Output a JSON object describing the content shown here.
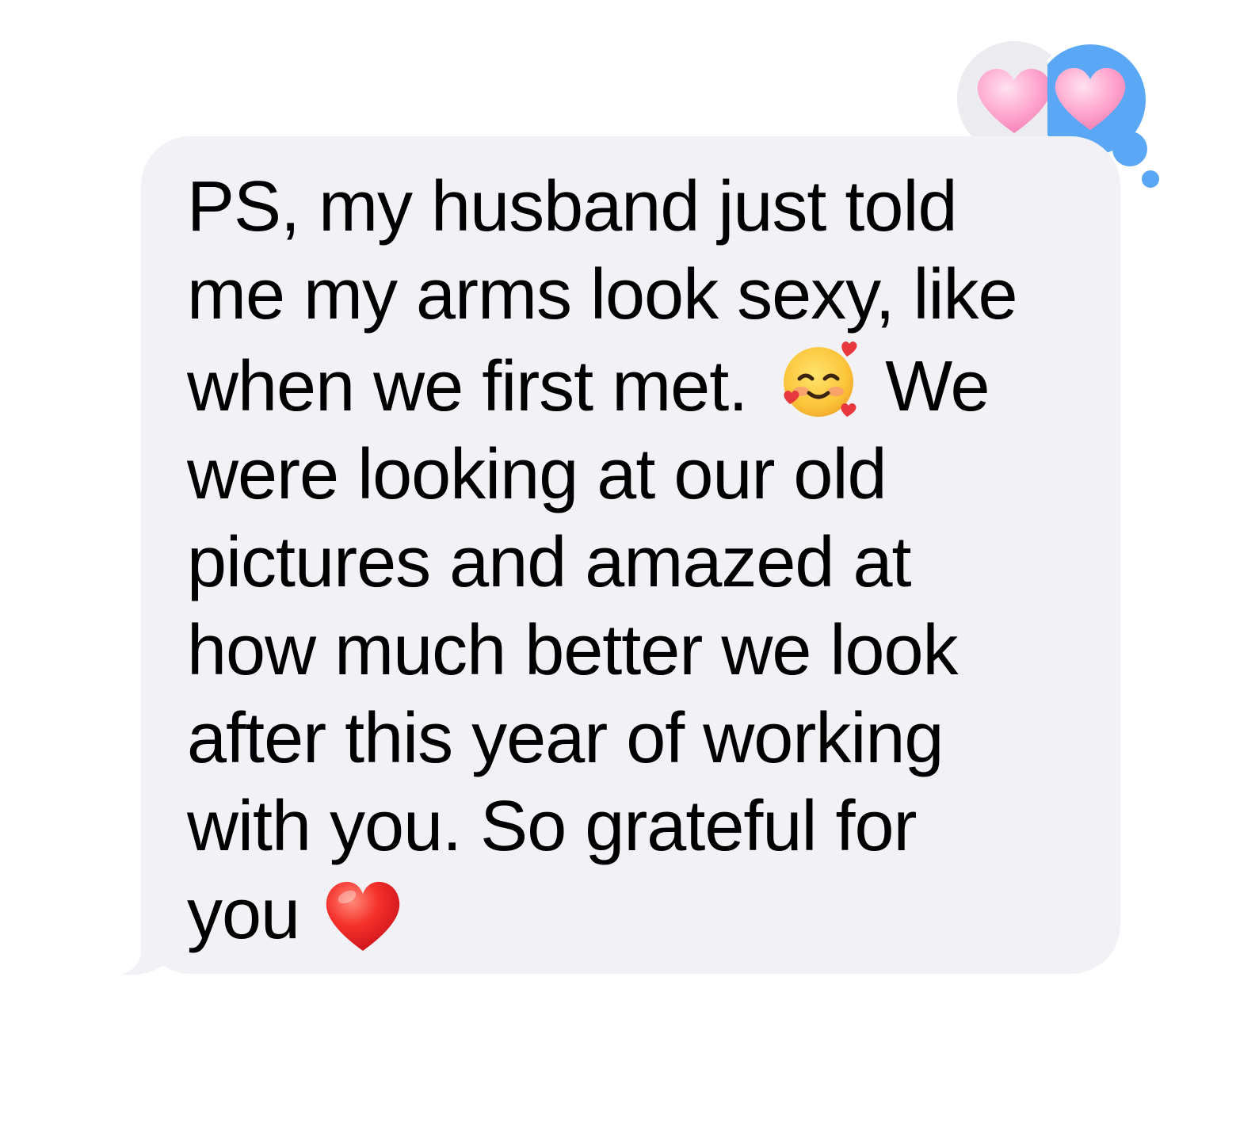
{
  "message": {
    "lines": [
      "PS, my husband just told",
      "me my arms look sexy, like",
      "when we first met.",
      "We",
      "were looking at our old",
      "pictures and amazed at",
      "how much better we look",
      "after this year of working",
      "with you.  So grateful for",
      "you"
    ],
    "emojis": [
      "smiling-face-with-hearts",
      "red-heart"
    ]
  },
  "reactions": [
    {
      "emoji": "pink-heart",
      "style": "received",
      "background": "#ececf0"
    },
    {
      "emoji": "pink-heart",
      "style": "sent",
      "background": "#5aa7f5"
    }
  ],
  "colors": {
    "bubble": "#f2f2f6",
    "text": "#000000",
    "blue_reaction": "#5aa7f5",
    "grey_reaction": "#ececf0"
  }
}
